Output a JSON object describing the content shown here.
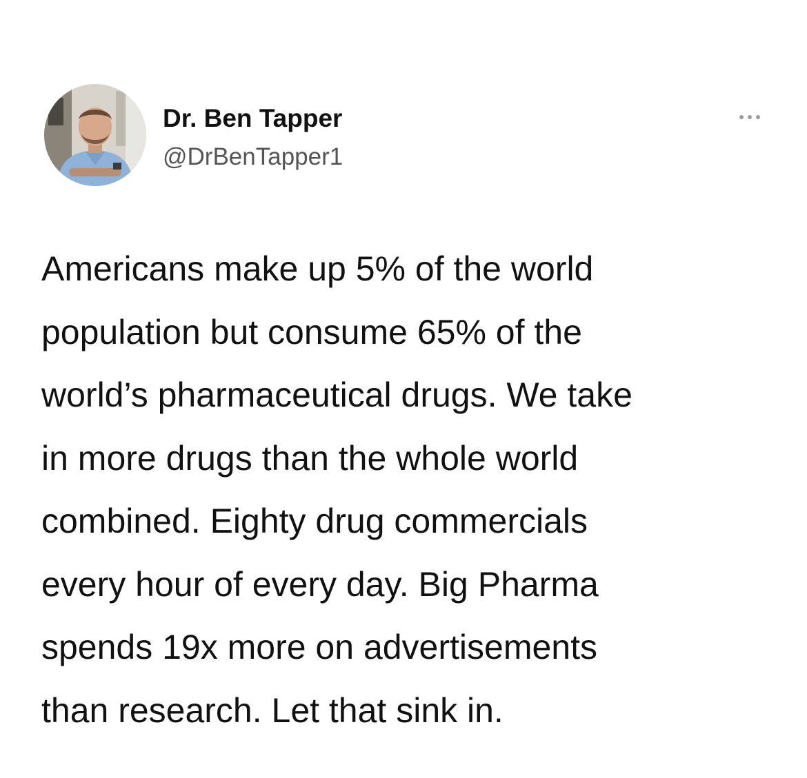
{
  "tweet": {
    "author": {
      "name": "Dr. Ben Tapper",
      "handle": "@DrBenTapper1",
      "avatar_icon": "profile-photo"
    },
    "more_icon": "more-options-icon",
    "text_lines": [
      "Americans make up 5% of the world",
      "population but consume 65% of the",
      "world’s pharmaceutical drugs. We take",
      "in more drugs than the whole world",
      "combined. Eighty drug commercials",
      "every hour of every day. Big Pharma",
      "spends 19x more on advertisements",
      "than research. Let that sink in."
    ]
  },
  "colors": {
    "background": "#ffffff",
    "text": "#111111",
    "handle": "#555555",
    "more_dots": "#9a9a9a"
  }
}
